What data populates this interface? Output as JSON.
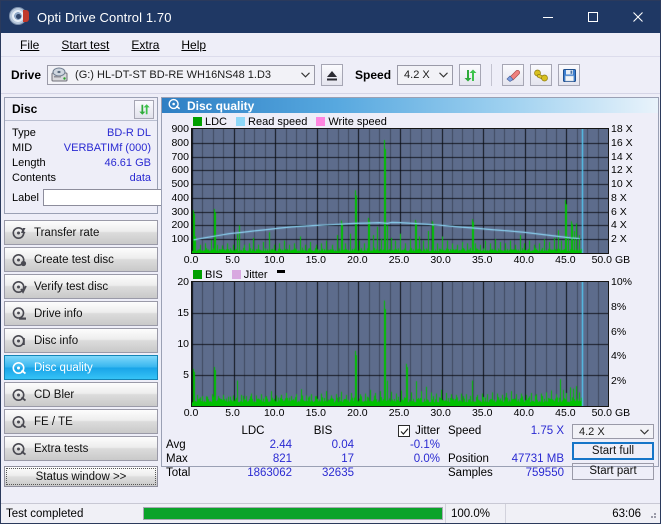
{
  "window": {
    "title": "Opti Drive Control 1.70",
    "icon": "disc-icon",
    "minimize": "minimize-icon",
    "maximize": "maximize-icon",
    "close": "close-icon"
  },
  "menu": {
    "items": [
      "File",
      "Start test",
      "Extra",
      "Help"
    ]
  },
  "drivebar": {
    "drive_label": "Drive",
    "drive_value": "(G:)  HL-DT-ST BD-RE  WH16NS48 1.D3",
    "eject_icon": "eject-icon",
    "speed_label": "Speed",
    "speed_value": "4.2 X",
    "refresh_icon": "refresh-icon",
    "erase_icon": "eraser-icon",
    "tools_icon": "tools-icon",
    "save_icon": "save-icon"
  },
  "disc": {
    "title": "Disc",
    "refresh_icon": "refresh-icon",
    "rows": [
      {
        "key": "Type",
        "value": "BD-R DL"
      },
      {
        "key": "MID",
        "value": "VERBATIMf (000)"
      },
      {
        "key": "Length",
        "value": "46.61 GB"
      },
      {
        "key": "Contents",
        "value": "data"
      }
    ],
    "label_key": "Label",
    "label_value": "",
    "label_placeholder": "",
    "label_button_icon": "disc-label-icon"
  },
  "nav": {
    "items": [
      {
        "label": "Transfer rate",
        "icon": "disc-speed-icon",
        "active": false
      },
      {
        "label": "Create test disc",
        "icon": "disc-create-icon",
        "active": false
      },
      {
        "label": "Verify test disc",
        "icon": "disc-verify-icon",
        "active": false
      },
      {
        "label": "Drive info",
        "icon": "drive-info-icon",
        "active": false
      },
      {
        "label": "Disc info",
        "icon": "disc-info-icon",
        "active": false
      },
      {
        "label": "Disc quality",
        "icon": "disc-quality-icon",
        "active": true
      },
      {
        "label": "CD Bler",
        "icon": "cd-bler-icon",
        "active": false
      },
      {
        "label": "FE / TE",
        "icon": "fe-te-icon",
        "active": false
      },
      {
        "label": "Extra tests",
        "icon": "extra-tests-icon",
        "active": false
      }
    ],
    "status_window": "Status window >>"
  },
  "panel": {
    "title": "Disc quality",
    "icon": "disc-quality-icon"
  },
  "stats": {
    "col_headers": [
      "LDC",
      "BIS"
    ],
    "row_headers": [
      "Avg",
      "Max",
      "Total"
    ],
    "ldc": {
      "avg": "2.44",
      "max": "821",
      "total": "1863062"
    },
    "bis": {
      "avg": "0.04",
      "max": "17",
      "total": "32635"
    },
    "jitter": {
      "label": "Jitter",
      "checked": true,
      "avg": "-0.1%",
      "max": "0.0%"
    },
    "speed_label": "Speed",
    "speed_value": "1.75 X",
    "position_label": "Position",
    "position_value": "47731 MB",
    "samples_label": "Samples",
    "samples_value": "759550",
    "speed_select": "4.2 X",
    "start_full": "Start full",
    "start_part": "Start part"
  },
  "statusbar": {
    "message": "Test completed",
    "percent": "100.0%",
    "percent_value": 100,
    "elapsed": "63:06"
  },
  "chart_data": [
    {
      "id": "ldc-chart",
      "type": "line",
      "title": "Disc quality",
      "xlabel": "GB",
      "ylabel": "LDC",
      "xlim": [
        0,
        50
      ],
      "ylim": [
        0,
        900
      ],
      "y2lim": [
        0,
        18
      ],
      "y2label": "X",
      "grid": true,
      "legend": [
        {
          "name": "LDC",
          "color": "#00a000"
        },
        {
          "name": "Read speed",
          "color": "#8ed8f8"
        },
        {
          "name": "Write speed",
          "color": "#ff86e0"
        }
      ],
      "xticks": [
        "0.0",
        "5.0",
        "10.0",
        "15.0",
        "20.0",
        "25.0",
        "30.0",
        "35.0",
        "40.0",
        "45.0",
        "50.0 GB"
      ],
      "yticks": [
        "900",
        "800",
        "700",
        "600",
        "500",
        "400",
        "300",
        "200",
        "100"
      ],
      "y2ticks": [
        "18 X",
        "16 X",
        "14 X",
        "12 X",
        "10 X",
        "8 X",
        "6 X",
        "4 X",
        "2 X"
      ],
      "series": [
        {
          "name": "Read speed",
          "color": "#8ed8f8",
          "axis": "right",
          "x": [
            0.2,
            1.5,
            3,
            4.5,
            6,
            7.5,
            9,
            10.5,
            12,
            13.5,
            15,
            16.5,
            18,
            19.5,
            21,
            22.5,
            23.5,
            24,
            25,
            26.5,
            28,
            30,
            32,
            34,
            36,
            38,
            40,
            42,
            44,
            45.5,
            46.6
          ],
          "y": [
            1.9,
            2.2,
            2.5,
            2.8,
            3.0,
            3.2,
            3.4,
            3.6,
            3.8,
            3.9,
            4.0,
            4.1,
            4.2,
            4.3,
            4.35,
            4.4,
            4.3,
            4.45,
            4.4,
            4.3,
            4.2,
            4.0,
            3.8,
            3.6,
            3.4,
            3.2,
            3.0,
            2.7,
            2.4,
            2.2,
            2.1
          ]
        },
        {
          "name": "LDC",
          "color": "#00c000",
          "axis": "left",
          "baseline": 25,
          "spikes": [
            [
              0.1,
              310
            ],
            [
              0.4,
              120
            ],
            [
              1.0,
              60
            ],
            [
              1.6,
              70
            ],
            [
              2.3,
              95
            ],
            [
              2.65,
              320
            ],
            [
              3.0,
              60
            ],
            [
              3.6,
              55
            ],
            [
              4.2,
              70
            ],
            [
              4.9,
              60
            ],
            [
              5.4,
              140
            ],
            [
              5.7,
              200
            ],
            [
              6.2,
              60
            ],
            [
              6.8,
              70
            ],
            [
              7.3,
              110
            ],
            [
              7.9,
              60
            ],
            [
              8.5,
              80
            ],
            [
              9.2,
              150
            ],
            [
              9.8,
              60
            ],
            [
              10.4,
              70
            ],
            [
              11.0,
              90
            ],
            [
              11.7,
              60
            ],
            [
              12.3,
              70
            ],
            [
              13.0,
              120
            ],
            [
              13.6,
              60
            ],
            [
              14.2,
              80
            ],
            [
              14.9,
              60
            ],
            [
              15.5,
              70
            ],
            [
              16.1,
              90
            ],
            [
              16.8,
              60
            ],
            [
              17.4,
              130
            ],
            [
              17.9,
              235
            ],
            [
              18.4,
              70
            ],
            [
              19.0,
              140
            ],
            [
              19.6,
              455
            ],
            [
              20.1,
              90
            ],
            [
              20.7,
              70
            ],
            [
              21.2,
              255
            ],
            [
              21.7,
              130
            ],
            [
              22.2,
              190
            ],
            [
              22.7,
              105
            ],
            [
              23.1,
              820
            ],
            [
              23.4,
              200
            ],
            [
              23.9,
              110
            ],
            [
              24.4,
              90
            ],
            [
              25.0,
              140
            ],
            [
              25.6,
              70
            ],
            [
              26.2,
              100
            ],
            [
              26.8,
              240
            ],
            [
              27.3,
              120
            ],
            [
              27.8,
              90
            ],
            [
              28.4,
              160
            ],
            [
              28.9,
              230
            ],
            [
              29.4,
              70
            ],
            [
              30.0,
              120
            ],
            [
              30.6,
              90
            ],
            [
              31.2,
              70
            ],
            [
              31.8,
              60
            ],
            [
              32.4,
              80
            ],
            [
              33.0,
              70
            ],
            [
              33.6,
              245
            ],
            [
              34.0,
              70
            ],
            [
              34.6,
              60
            ],
            [
              35.2,
              90
            ],
            [
              35.8,
              70
            ],
            [
              36.4,
              100
            ],
            [
              37.0,
              80
            ],
            [
              37.6,
              70
            ],
            [
              38.2,
              90
            ],
            [
              38.8,
              60
            ],
            [
              39.4,
              130
            ],
            [
              39.9,
              70
            ],
            [
              40.5,
              90
            ],
            [
              41.1,
              60
            ],
            [
              41.7,
              70
            ],
            [
              42.3,
              100
            ],
            [
              42.9,
              80
            ],
            [
              43.5,
              110
            ],
            [
              44.0,
              165
            ],
            [
              44.4,
              90
            ],
            [
              44.8,
              385
            ],
            [
              45.2,
              120
            ],
            [
              45.6,
              230
            ],
            [
              45.9,
              160
            ],
            [
              46.2,
              215
            ],
            [
              46.5,
              130
            ]
          ]
        }
      ],
      "cursor_x": 46.9
    },
    {
      "id": "bis-chart",
      "type": "line",
      "xlabel": "GB",
      "ylabel": "BIS",
      "xlim": [
        0,
        50
      ],
      "ylim": [
        0,
        20
      ],
      "y2lim": [
        0,
        10
      ],
      "y2label": "%",
      "grid": true,
      "legend": [
        {
          "name": "BIS",
          "color": "#00a000"
        },
        {
          "name": "Jitter",
          "color": "#d8a8e0"
        }
      ],
      "xticks": [
        "0.0",
        "5.0",
        "10.0",
        "15.0",
        "20.0",
        "25.0",
        "30.0",
        "35.0",
        "40.0",
        "45.0",
        "50.0 GB"
      ],
      "yticks": [
        "20",
        "15",
        "10",
        "5"
      ],
      "y2ticks": [
        "10%",
        "8%",
        "6%",
        "4%",
        "2%"
      ],
      "series": [
        {
          "name": "BIS",
          "color": "#00c000",
          "axis": "left",
          "baseline": 1.1,
          "spikes": [
            [
              0.1,
              6.0
            ],
            [
              0.6,
              1.8
            ],
            [
              1.2,
              1.6
            ],
            [
              1.8,
              1.5
            ],
            [
              2.4,
              1.9
            ],
            [
              2.65,
              6.3
            ],
            [
              3.1,
              1.6
            ],
            [
              3.7,
              1.8
            ],
            [
              4.3,
              1.5
            ],
            [
              4.9,
              1.7
            ],
            [
              5.4,
              4.1
            ],
            [
              5.9,
              1.8
            ],
            [
              6.5,
              1.6
            ],
            [
              7.1,
              2.0
            ],
            [
              7.7,
              1.7
            ],
            [
              8.3,
              1.9
            ],
            [
              8.9,
              1.6
            ],
            [
              9.5,
              2.4
            ],
            [
              10.1,
              1.7
            ],
            [
              10.7,
              1.8
            ],
            [
              11.3,
              2.1
            ],
            [
              11.9,
              1.6
            ],
            [
              12.5,
              1.9
            ],
            [
              13.1,
              2.7
            ],
            [
              13.7,
              1.7
            ],
            [
              14.3,
              1.9
            ],
            [
              14.9,
              1.6
            ],
            [
              15.5,
              2.0
            ],
            [
              16.1,
              2.4
            ],
            [
              16.7,
              1.7
            ],
            [
              17.3,
              1.9
            ],
            [
              17.9,
              2.3
            ],
            [
              18.5,
              1.8
            ],
            [
              19.1,
              2.1
            ],
            [
              19.6,
              8.9
            ],
            [
              20.2,
              1.9
            ],
            [
              20.8,
              2.0
            ],
            [
              21.4,
              2.6
            ],
            [
              22.0,
              2.1
            ],
            [
              22.6,
              2.4
            ],
            [
              23.1,
              17.0
            ],
            [
              23.4,
              4.1
            ],
            [
              23.9,
              2.3
            ],
            [
              24.5,
              2.0
            ],
            [
              25.1,
              2.5
            ],
            [
              25.7,
              6.8
            ],
            [
              26.3,
              2.2
            ],
            [
              26.9,
              4.0
            ],
            [
              27.5,
              2.4
            ],
            [
              28.1,
              3.1
            ],
            [
              28.7,
              2.2
            ],
            [
              29.3,
              2.0
            ],
            [
              29.9,
              2.6
            ],
            [
              30.5,
              2.1
            ],
            [
              31.1,
              1.9
            ],
            [
              31.7,
              1.8
            ],
            [
              32.3,
              2.0
            ],
            [
              32.9,
              1.9
            ],
            [
              33.6,
              4.1
            ],
            [
              34.2,
              1.8
            ],
            [
              34.8,
              2.0
            ],
            [
              35.4,
              1.9
            ],
            [
              36.0,
              2.2
            ],
            [
              36.6,
              2.0
            ],
            [
              37.2,
              1.8
            ],
            [
              37.8,
              2.1
            ],
            [
              38.4,
              2.4
            ],
            [
              39.0,
              1.9
            ],
            [
              39.6,
              2.0
            ],
            [
              40.2,
              1.8
            ],
            [
              40.8,
              2.1
            ],
            [
              41.4,
              1.9
            ],
            [
              42.0,
              2.0
            ],
            [
              42.6,
              2.2
            ],
            [
              43.2,
              2.5
            ],
            [
              43.8,
              1.9
            ],
            [
              44.2,
              4.3
            ],
            [
              44.6,
              2.6
            ],
            [
              45.0,
              2.1
            ],
            [
              45.4,
              3.0
            ],
            [
              45.8,
              2.8
            ],
            [
              46.2,
              3.2
            ],
            [
              46.5,
              2.2
            ]
          ]
        }
      ],
      "cursor_x": 46.9
    }
  ]
}
